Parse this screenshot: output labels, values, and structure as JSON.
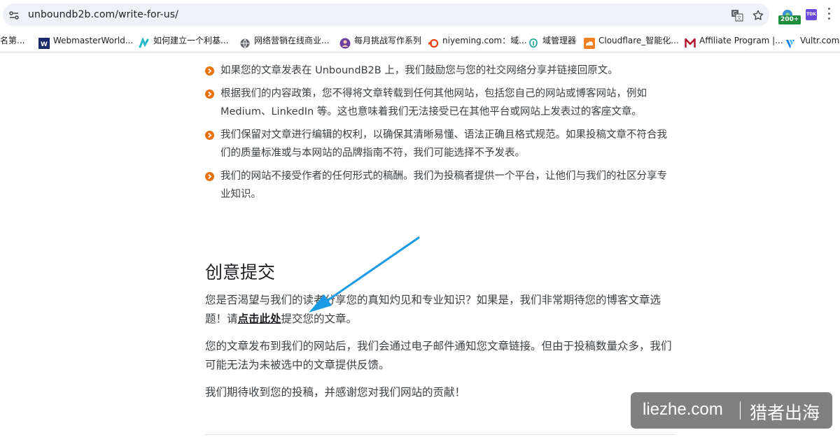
{
  "browser": {
    "url": "unboundb2b.com/write-for-us/",
    "extension_badge": "200+",
    "extension_tdk": "TDK"
  },
  "bookmarks": [
    {
      "label": "名第...",
      "icon": "none"
    },
    {
      "label": "WebmasterWorld...",
      "icon": "webmasterworld-icon"
    },
    {
      "label": "如何建立一个利基...",
      "icon": "bookmark-wave-icon"
    },
    {
      "label": "网络营销在线商业...",
      "icon": "globe-icon"
    },
    {
      "label": "每月挑战写作系列",
      "icon": "avatar-icon"
    },
    {
      "label": "niyeming.com：域...",
      "icon": "niyeming-icon"
    },
    {
      "label": "域管理器",
      "icon": "domain-manager-icon"
    },
    {
      "label": "Cloudflare_智能化...",
      "icon": "cloudflare-icon"
    },
    {
      "label": "Affiliate Program |...",
      "icon": "affiliate-m-icon"
    },
    {
      "label": "Vultr.com",
      "icon": "vultr-icon"
    }
  ],
  "rules": [
    "如果您的文章发表在 UnboundB2B 上，我们鼓励您与您的社交网络分享并链接回原文。",
    "根据我们的内容政策，您不得将文章转载到任何其他网站，包括您自己的网站或博客网站，例如 Medium、LinkedIn 等。这也意味着我们无法接受已在其他平台或网站上发表过的客座文章。",
    "我们保留对文章进行编辑的权利，以确保其清晰易懂、语法正确且格式规范。如果投稿文章不符合我们的质量标准或与本网站的品牌指南不符，我们可能选择不予发表。",
    "我们的网站不接受作者的任何形式的稿酬。我们为投稿者提供一个平台，让他们与我们的社区分享专业知识。"
  ],
  "section": {
    "heading": "创意提交",
    "para1_before": "您是否渴望与我们的读者分享您的真知灼见和专业知识？如果是，我们非常期待您的博客文章选题！请",
    "para1_link": "点击此处",
    "para1_after": "提交您的文章。",
    "para2": "您的文章发布到我们的网站后，我们会通过电子邮件通知您文章链接。但由于投稿数量众多，我们可能无法为未被选中的文章提供反馈。",
    "para3": "我们期待收到您的投稿，并感谢您对我们网站的贡献！"
  },
  "watermark": {
    "left": "liezhe.com",
    "right": "猎者出海"
  },
  "colors": {
    "bullet": "#e8710a",
    "arrow": "#1a9be6"
  }
}
